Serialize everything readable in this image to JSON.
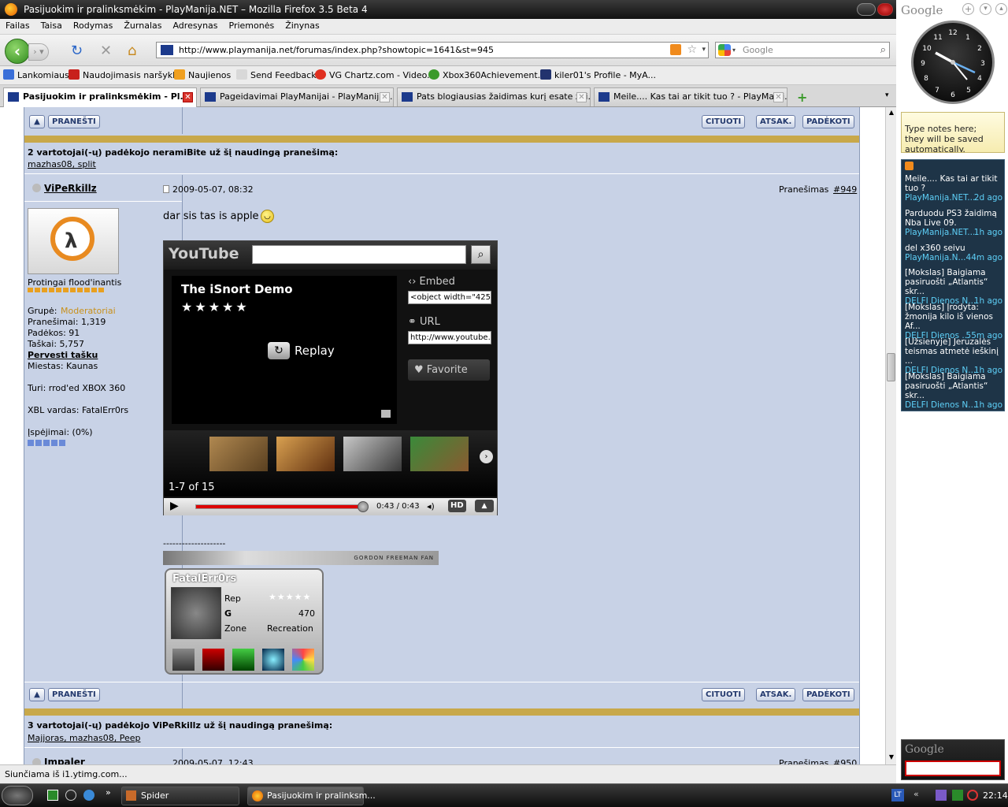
{
  "window": {
    "title": "Pasijuokim ir pralinksmėkim - PlayManija.NET – Mozilla Firefox 3.5 Beta 4"
  },
  "menu": [
    "Failas",
    "Taisa",
    "Rodymas",
    "Žurnalas",
    "Adresynas",
    "Priemonės",
    "Žinynas"
  ],
  "nav": {
    "url": "http://www.playmanija.net/forumas/index.php?showtopic=1641&st=945",
    "search_placeholder": "Google"
  },
  "bookmarks": [
    {
      "label": "Lankomiausi",
      "color": "#3a6fd8"
    },
    {
      "label": "Naudojimasis naršykle",
      "color": "#c8201c"
    },
    {
      "label": "Naujienos",
      "color": "#f0a020"
    },
    {
      "label": "Send Feedback",
      "color": "#d8d8d8"
    },
    {
      "label": "VG Chartz.com - Video...",
      "color": "#e03020"
    },
    {
      "label": "Xbox360Achievement...",
      "color": "#3a9a2a"
    },
    {
      "label": "kiler01's Profile - MyA...",
      "color": "#22336e"
    }
  ],
  "tabs": [
    {
      "label": "Pasijuokim ir pralinksmėkim - Pl...",
      "active": true
    },
    {
      "label": "Pageidavimai PlayManijai - PlayManija....",
      "active": false
    },
    {
      "label": "Pats blogiausias žaidimas kurį esate žai...",
      "active": false
    },
    {
      "label": "Meile.... Kas tai ar tikit tuo ? - PlayManij...",
      "active": false
    }
  ],
  "buttons": {
    "pranesti": "PRANEŠTI",
    "cituoti": "CITUOTI",
    "atsak": "ATSAK.",
    "padekoti": "PADĖKOTI"
  },
  "thanks1": {
    "text": "2 vartotojai(-ų) padėkojo neramiBite už šį naudingą pranešimą:",
    "users": "mazhas08, split"
  },
  "post": {
    "author": "ViPeRkillz",
    "date": "2009-05-07, 08:32",
    "num_label": "Pranešimas",
    "num": "#949",
    "rank": "Protingai flood'inantis",
    "group_label": "Grupė:",
    "group": "Moderatoriai",
    "posts": "Pranešimai: 1,319",
    "thanks": "Padėkos: 91",
    "points": "Taškai: 5,757",
    "transfer": "Pervesti tašku",
    "city": "Miestas: Kaunas",
    "owns": "Turi: rrod'ed XBOX 360",
    "xbl": "XBL vardas: FatalErr0rs",
    "warn": "Įspėjimai: (0%)",
    "message": "dar sis tas is apple"
  },
  "youtube": {
    "logo": "YouTube",
    "title": "The iSnort Demo",
    "replay": "Replay",
    "embed_label": "Embed",
    "embed_value": "<object width=\"425\" h",
    "url_label": "URL",
    "url_value": "http://www.youtube.",
    "favorite": "Favorite",
    "count": "1-7 of 15",
    "time": "0:43 / 0:43",
    "hd": "HD",
    "progress": 1.0
  },
  "signature": {
    "dashes": "--------------------",
    "banner": "GORDON FREEMAN FAN",
    "gamertag": "FatalErr0rs",
    "rep_label": "Rep",
    "g_label": "G",
    "g_value": "470",
    "zone_label": "Zone",
    "zone_value": "Recreation"
  },
  "thanks2": {
    "text": "3 vartotojai(-ų) padėkojo ViPeRkillz už šį naudingą pranešimą:",
    "users": "Majjoras, mazhas08, Peep"
  },
  "post2": {
    "author": "Impaler",
    "date": "2009-05-07, 12:43",
    "num_label": "Pranešimas",
    "num": "#950"
  },
  "status": "Siunčiama iš i1.ytimg.com...",
  "taskbar": {
    "spider": "Spider",
    "firefox": "Pasijuokim ir pralinksm...",
    "lang": "LT",
    "time": "22:14"
  },
  "sidebar": {
    "google": "Google",
    "notes": "Type notes here; they will be saved automatically.",
    "feeds": [
      {
        "title": "Meile.... Kas tai ar tikit tuo ?",
        "src": "PlayManija.NET...",
        "ago": "2d ago"
      },
      {
        "title": "Parduodu PS3 žaidimą Nba Live 09.",
        "src": "PlayManija.NET...",
        "ago": "1h ago"
      },
      {
        "title": "del x360 seivu",
        "src": "PlayManija.N...",
        "ago": "44m ago"
      },
      {
        "title": "[Mokslas] Baigiama pasiruošti „Atlantis“ skr...",
        "src": "DELFI Dienos N...",
        "ago": "1h ago"
      },
      {
        "title": "[Mokslas] Įrodyta: žmonija kilo iš vienos Af...",
        "src": "DELFI Dienos ...",
        "ago": "55m ago"
      },
      {
        "title": "[Užsienyje] Jeruzalės teismas atmetė ieškinį ...",
        "src": "DELFI Dienos N...",
        "ago": "1h ago"
      },
      {
        "title": "[Mokslas] Baigiama pasiruošti „Atlantis“ skr...",
        "src": "DELFI Dienos N...",
        "ago": "1h ago"
      }
    ]
  }
}
